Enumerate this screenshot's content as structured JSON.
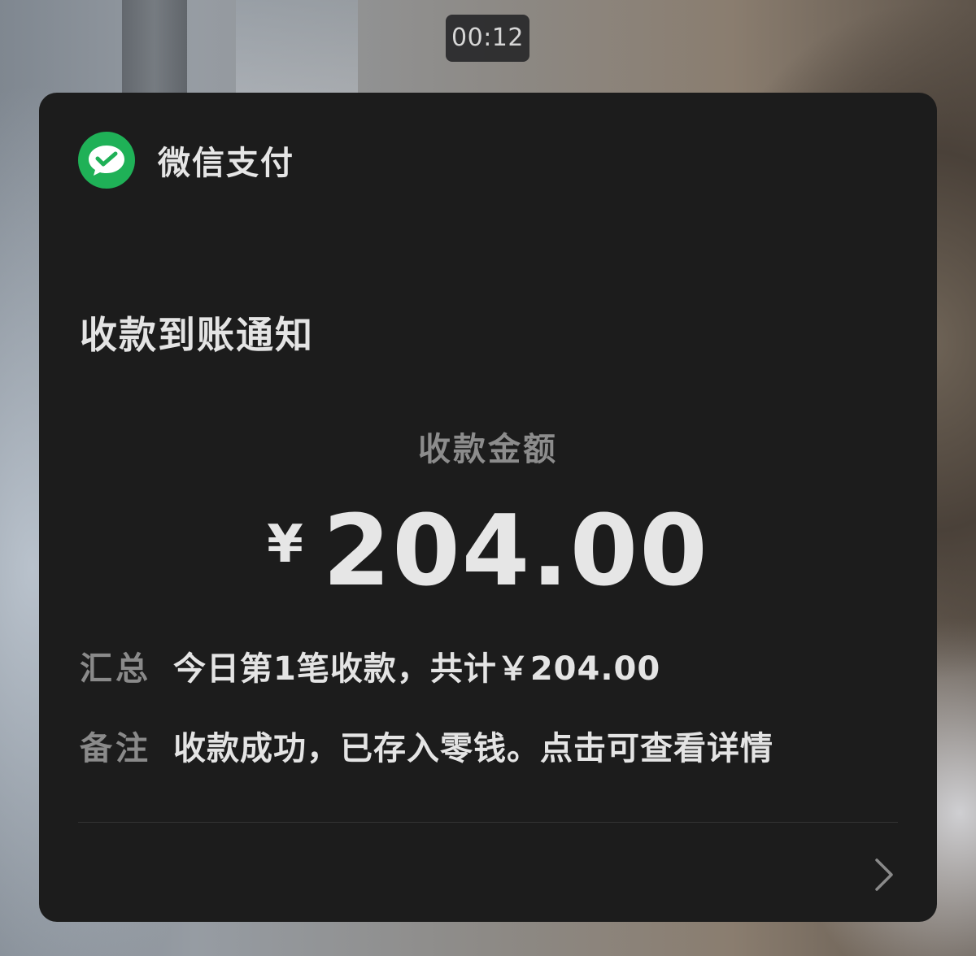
{
  "status": {
    "time": "00:12"
  },
  "notification": {
    "app_name": "微信支付",
    "app_icon": "wechat-pay-icon",
    "brand_color": "#1fb157",
    "title": "收款到账通知",
    "amount_label": "收款金额",
    "currency_symbol": "¥",
    "amount": "204.00",
    "summary": {
      "label": "汇总",
      "value": "今日第1笔收款，共计￥204.00"
    },
    "remark": {
      "label": "备注",
      "value": "收款成功，已存入零钱。点击可查看详情"
    },
    "footer_icon": "chevron-right-icon"
  }
}
